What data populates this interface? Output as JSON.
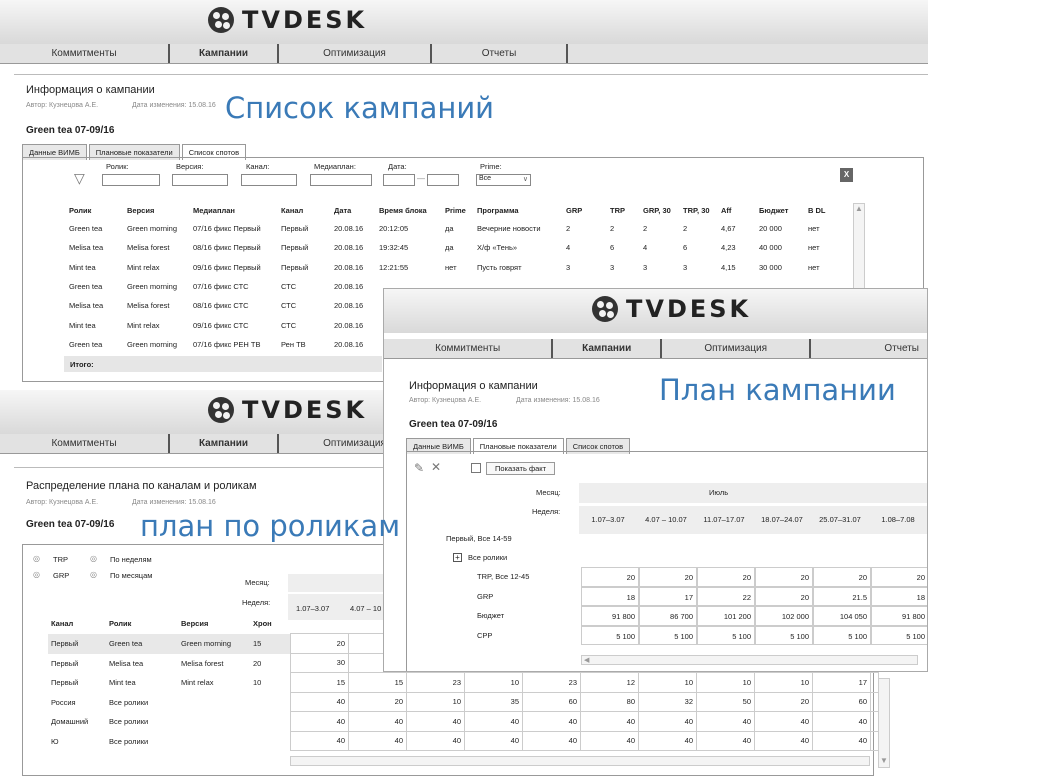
{
  "app": {
    "logo": "TVDESK"
  },
  "nav": [
    "Коммитменты",
    "Кампании",
    "Оптимизация",
    "Отчеты"
  ],
  "annotations": {
    "list": "Список кампаний",
    "plan": "План кампании",
    "roliki": "план по роликам"
  },
  "p1": {
    "title": "Информация о кампании",
    "author": "Автор: Кузнецова А.Е.",
    "date": "Дата изменения: 15.08.16",
    "campaign": "Green tea 07-09/16",
    "tabs": [
      "Данные ВИМБ",
      "Плановые показатели",
      "Список спотов"
    ],
    "filters": {
      "rolik": "Ролик:",
      "version": "Версия:",
      "channel": "Канал:",
      "mediaplan": "Медиаплан:",
      "date": "Дата:",
      "prime": "Prime:",
      "prime_value": "Все"
    },
    "columns": [
      "Ролик",
      "Версия",
      "Медиаплан",
      "Канал",
      "Дата",
      "Время блока",
      "Prime",
      "Программа",
      "GRP",
      "TRP",
      "GRP, 30",
      "TRP, 30",
      "Aff",
      "Бюджет",
      "В DL"
    ],
    "rows": [
      [
        "Green tea",
        "Green morning",
        "07/16 фикс Первый",
        "Первый",
        "20.08.16",
        "20:12:05",
        "да",
        "Вечерние новости",
        "2",
        "2",
        "2",
        "2",
        "4,67",
        "20 000",
        "нет"
      ],
      [
        "Melisa tea",
        "Melisa forest",
        "08/16 фикс Первый",
        "Первый",
        "20.08.16",
        "19:32:45",
        "да",
        "Х/ф «Тень»",
        "4",
        "6",
        "4",
        "6",
        "4,23",
        "40 000",
        "нет"
      ],
      [
        "Mint tea",
        "Mint relax",
        "09/16 фикс Первый",
        "Первый",
        "20.08.16",
        "12:21:55",
        "нет",
        "Пусть говрят",
        "3",
        "3",
        "3",
        "3",
        "4,15",
        "30 000",
        "нет"
      ],
      [
        "Green tea",
        "Green morning",
        "07/16 фикс СТС",
        "СТС",
        "20.08.16",
        "",
        "",
        "",
        "",
        "",
        "",
        "",
        "",
        "",
        ""
      ],
      [
        "Melisa tea",
        "Melisa forest",
        "08/16 фикс СТС",
        "СТС",
        "20.08.16",
        "",
        "",
        "",
        "",
        "",
        "",
        "",
        "",
        "",
        ""
      ],
      [
        "Mint tea",
        "Mint relax",
        "09/16 фикс СТС",
        "СТС",
        "20.08.16",
        "",
        "",
        "",
        "",
        "",
        "",
        "",
        "",
        "",
        ""
      ],
      [
        "Green tea",
        "Green morning",
        "07/16 фикс РЕН ТВ",
        "Рен ТВ",
        "20.08.16",
        "",
        "",
        "",
        "",
        "",
        "",
        "",
        "",
        "",
        ""
      ]
    ],
    "total": "Итого:"
  },
  "p2": {
    "title": "Информация о кампании",
    "author": "Автор: Кузнецова А.Е.",
    "date": "Дата изменения: 15.08.16",
    "campaign": "Green tea 07-09/16",
    "tabs": [
      "Данные ВИМБ",
      "Плановые показатели",
      "Список спотов"
    ],
    "show_fact": "Показать факт",
    "month_label": "Месяц:",
    "month": "Июль",
    "week_label": "Неделя:",
    "weeks": [
      "1.07–3.07",
      "4.07 – 10.07",
      "11.07–17.07",
      "18.07–24.07",
      "25.07–31.07",
      "1.08–7.08"
    ],
    "group": "Первый, Все 14-59",
    "all_rolls": "Все ролики",
    "metrics": [
      {
        "name": "TRP, Все 12-45",
        "values": [
          "20",
          "20",
          "20",
          "20",
          "20",
          "20"
        ]
      },
      {
        "name": "GRP",
        "values": [
          "18",
          "17",
          "22",
          "20",
          "21.5",
          "18"
        ]
      },
      {
        "name": "Бюджет",
        "values": [
          "91 800",
          "86 700",
          "101 200",
          "102 000",
          "104 050",
          "91 800"
        ]
      },
      {
        "name": "CPP",
        "values": [
          "5 100",
          "5 100",
          "5 100",
          "5 100",
          "5 100",
          "5 100"
        ]
      }
    ]
  },
  "p3": {
    "title": "Распределение плана по каналам и роликам",
    "author": "Автор: Кузнецова А.Е.",
    "date": "Дата изменения: 15.08.16",
    "campaign": "Green tea 07-09/16",
    "radios": [
      "TRP",
      "По неделям",
      "GRP",
      "По месяцам"
    ],
    "month_label": "Месяц:",
    "week_label": "Неделя:",
    "weeks": [
      "1.07–3.07",
      "4.07 – 10"
    ],
    "columns": [
      "Канал",
      "Ролик",
      "Версия",
      "Хрон"
    ],
    "rows": [
      {
        "c": "Первый",
        "r": "Green tea",
        "v": "Green morning",
        "h": "15",
        "vals": [
          "20",
          "",
          "",
          "",
          "",
          "",
          "",
          "",
          "",
          "",
          ""
        ]
      },
      {
        "c": "Первый",
        "r": "Melisa tea",
        "v": "Melisa forest",
        "h": "20",
        "vals": [
          "30",
          "",
          "",
          "",
          "",
          "",
          "",
          "",
          "",
          "",
          ""
        ]
      },
      {
        "c": "Первый",
        "r": "Mint tea",
        "v": "Mint relax",
        "h": "10",
        "vals": [
          "15",
          "15",
          "23",
          "10",
          "23",
          "12",
          "10",
          "10",
          "10",
          "17",
          ""
        ]
      },
      {
        "c": "Россия",
        "r": "Все ролики",
        "v": "",
        "h": "",
        "vals": [
          "40",
          "20",
          "10",
          "35",
          "60",
          "80",
          "32",
          "50",
          "20",
          "60",
          ""
        ]
      },
      {
        "c": "Домашний",
        "r": "Все ролики",
        "v": "",
        "h": "",
        "vals": [
          "40",
          "40",
          "40",
          "40",
          "40",
          "40",
          "40",
          "40",
          "40",
          "40",
          ""
        ]
      },
      {
        "c": "Ю",
        "r": "Все ролики",
        "v": "",
        "h": "",
        "vals": [
          "40",
          "40",
          "40",
          "40",
          "40",
          "40",
          "40",
          "40",
          "40",
          "40",
          ""
        ]
      }
    ]
  }
}
